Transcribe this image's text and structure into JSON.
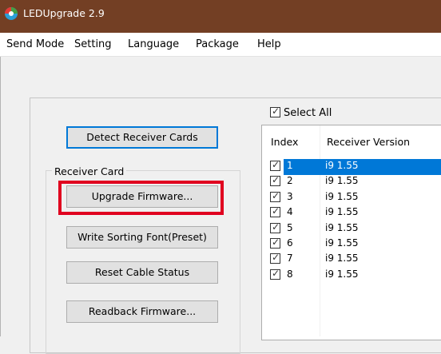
{
  "window": {
    "title": "LEDUpgrade 2.9"
  },
  "menu": [
    "Send Mode",
    "Setting",
    "Language",
    "Package",
    "Help"
  ],
  "buttons": {
    "detect": "Detect Receiver Cards",
    "upgrade": "Upgrade Firmware...",
    "write_sorting": "Write Sorting Font(Preset)",
    "reset_cable": "Reset Cable Status",
    "readback": "Readback Firmware..."
  },
  "receiver_card": {
    "label": "Receiver Card"
  },
  "select_all": {
    "label": "Select All",
    "checked": true
  },
  "table": {
    "headers": [
      "Index",
      "Receiver Version"
    ],
    "rows": [
      {
        "index": "1",
        "version": "i9 1.55",
        "checked": true,
        "selected": true
      },
      {
        "index": "2",
        "version": "i9 1.55",
        "checked": true,
        "selected": false
      },
      {
        "index": "3",
        "version": "i9 1.55",
        "checked": true,
        "selected": false
      },
      {
        "index": "4",
        "version": "i9 1.55",
        "checked": true,
        "selected": false
      },
      {
        "index": "5",
        "version": "i9 1.55",
        "checked": true,
        "selected": false
      },
      {
        "index": "6",
        "version": "i9 1.55",
        "checked": true,
        "selected": false
      },
      {
        "index": "7",
        "version": "i9 1.55",
        "checked": true,
        "selected": false
      },
      {
        "index": "8",
        "version": "i9 1.55",
        "checked": true,
        "selected": false
      }
    ]
  },
  "colors": {
    "titlebar": "#733f24",
    "selection": "#0078d7",
    "highlight_box": "#e0001f"
  }
}
